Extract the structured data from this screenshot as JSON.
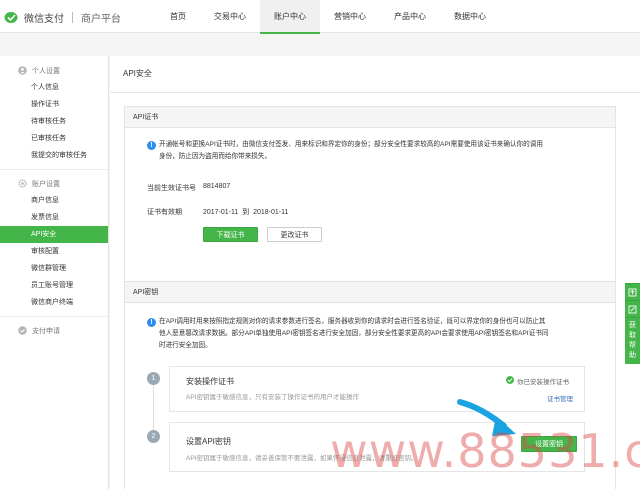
{
  "header": {
    "brand": "微信支付",
    "sub": "商户平台",
    "nav": [
      "首页",
      "交易中心",
      "账户中心",
      "营销中心",
      "产品中心",
      "数据中心"
    ],
    "active_nav": 2
  },
  "sidebar": {
    "groups": [
      {
        "title": "个人设置",
        "items": [
          "个人信息",
          "操作证书",
          "待审核任务",
          "已审核任务",
          "我提交的审核任务"
        ]
      },
      {
        "title": "账户设置",
        "items": [
          "商户信息",
          "发票信息",
          "API安全",
          "审核配置",
          "微信群管理",
          "员工账号管理",
          "微信商户终端"
        ]
      },
      {
        "title": "支付申请",
        "items": []
      }
    ],
    "active_item": "API安全"
  },
  "main": {
    "title": "API安全",
    "cert_panel": {
      "head": "API证书",
      "notice_line1": "开通帐号和更换API证书时，由微信支付签发、用来标识和界定你的身份；部分安全性要求较高的API需要使用该证书来确认你的调用",
      "notice_line2": "身份，防止因为盗用而给你带来损失。",
      "serial_label": "当前生效证书号",
      "serial_value": "8814807",
      "validity_label": "证书有效期",
      "validity_value": "2017-01-11  到  2018-01-11",
      "download_btn": "下载证书",
      "change_btn": "更改证书"
    },
    "key_panel": {
      "head": "API密钥",
      "notice_line1": "在API调用时用来按照指定规则对你的请求参数进行签名，服务器收到你的请求时会进行签名验证，既可以界定你的身份也可以防止其",
      "notice_line2": "他人恶意篡改请求数据。部分API单独使用API密钥签名进行安全加固，部分安全性要求更高的API会要求使用API密钥签名和API证书同",
      "notice_line3": "时进行安全加固。",
      "steps": [
        {
          "num": "1",
          "title": "安装操作证书",
          "desc": "API密钥属于敏感信息，只有安装了操作证书的用户才能操作",
          "status": "你已安装操作证书",
          "link": "证书管理"
        },
        {
          "num": "2",
          "title": "设置API密钥",
          "desc": "API密钥属于敏感信息，请妥善保管不要泄露，如果怀疑信息泄露，请重设密钥。",
          "button": "设置密钥"
        }
      ]
    }
  },
  "right_tool": {
    "label_chars": [
      "获",
      "取",
      "帮",
      "助"
    ]
  },
  "watermark": "www.88531.cn",
  "colors": {
    "brand_green": "#44b549",
    "info_blue": "#2d8cf0",
    "arrow_blue": "#1aa3e0",
    "link_blue": "#3a6fc1"
  }
}
